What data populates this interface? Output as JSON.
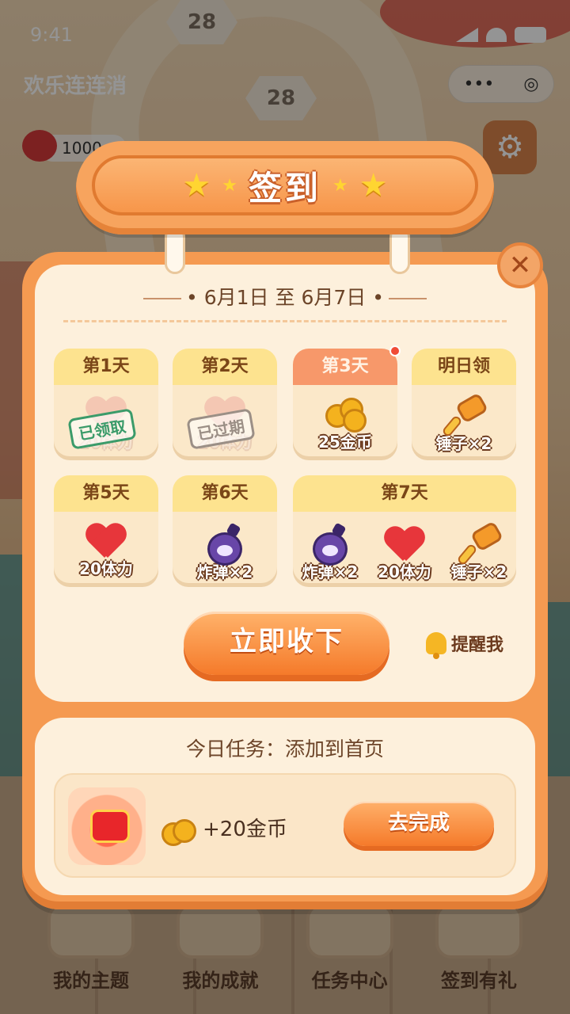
{
  "status_bar": {
    "time": "9:41"
  },
  "game": {
    "title": "欢乐连连消",
    "hearts": "1000",
    "level_a": "28",
    "level_b": "28",
    "capsule_more": "•••",
    "capsule_close": "◎"
  },
  "bottom_nav": [
    {
      "label": "我的主题"
    },
    {
      "label": "我的成就"
    },
    {
      "label": "任务中心"
    },
    {
      "label": "签到有礼"
    }
  ],
  "dialog": {
    "title": "签到",
    "close_glyph": "✕",
    "date_range": "6月1日 至 6月7日",
    "days": [
      {
        "header": "第1天",
        "rewards": [
          {
            "icon": "heart-icon",
            "label": "20体力"
          }
        ],
        "stamp": "已领取",
        "state": "claimed"
      },
      {
        "header": "第2天",
        "rewards": [
          {
            "icon": "heart-icon",
            "label": "20体力"
          }
        ],
        "stamp": "已过期",
        "state": "expired"
      },
      {
        "header": "第3天",
        "rewards": [
          {
            "icon": "coin-icon",
            "label": "25金币"
          }
        ],
        "state": "today"
      },
      {
        "header": "明日领",
        "rewards": [
          {
            "icon": "hammer-icon",
            "label": "锤子×2"
          }
        ],
        "state": "upcoming"
      },
      {
        "header": "第5天",
        "rewards": [
          {
            "icon": "heart-icon",
            "label": "20体力"
          }
        ],
        "state": "upcoming"
      },
      {
        "header": "第6天",
        "rewards": [
          {
            "icon": "bomb-icon",
            "label": "炸弹×2"
          }
        ],
        "state": "upcoming"
      },
      {
        "header": "第7天",
        "rewards": [
          {
            "icon": "bomb-icon",
            "label": "炸弹×2"
          },
          {
            "icon": "heart-icon",
            "label": "20体力"
          },
          {
            "icon": "hammer-icon",
            "label": "锤子×2"
          }
        ],
        "state": "upcoming"
      }
    ],
    "claim_button": "立即收下",
    "remind_label": "提醒我",
    "task": {
      "title": "今日任务：添加到首页",
      "reward": "+20金币",
      "button": "去完成"
    }
  },
  "colors": {
    "dialog_orange": "#f59a51",
    "panel_cream": "#fdf0dc",
    "header_yellow": "#fde38f",
    "today_header": "#f7986a",
    "button_orange": "#f57a2a"
  }
}
